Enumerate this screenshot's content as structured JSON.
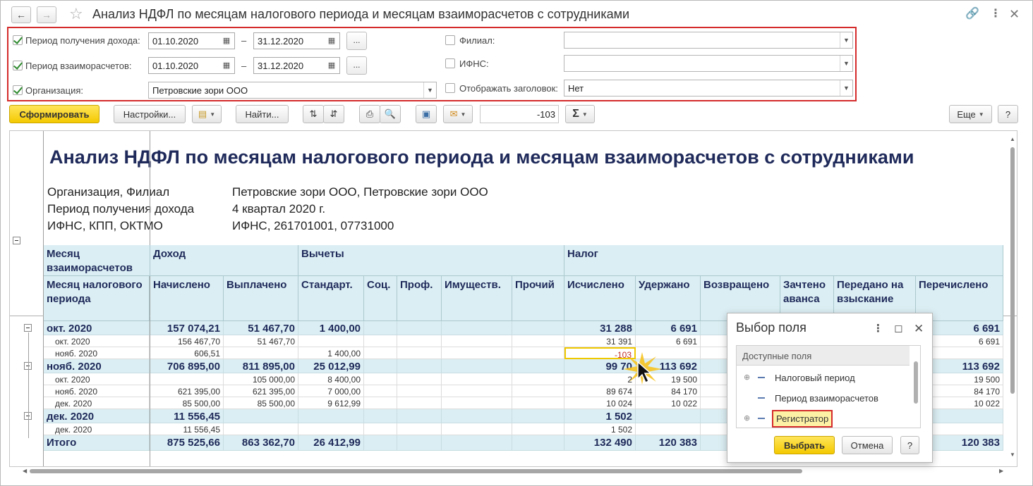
{
  "window": {
    "title": "Анализ НДФЛ по месяцам налогового периода и месяцам взаиморасчетов с сотрудниками"
  },
  "params": {
    "income_period": {
      "label": "Период получения дохода:",
      "checked": true,
      "from": "01.10.2020",
      "to": "31.12.2020"
    },
    "settlement_period": {
      "label": "Период взаиморасчетов:",
      "checked": true,
      "from": "01.10.2020",
      "to": "31.12.2020"
    },
    "organization": {
      "label": "Организация:",
      "checked": true,
      "value": "Петровские зори ООО"
    },
    "branch": {
      "label": "Филиал:",
      "checked": false,
      "value": ""
    },
    "ifns": {
      "label": "ИФНС:",
      "checked": false,
      "value": ""
    },
    "show_header": {
      "label": "Отображать заголовок:",
      "checked": false,
      "value": "Нет"
    },
    "dash": "–",
    "dots": "..."
  },
  "toolbar": {
    "generate": "Сформировать",
    "settings": "Настройки...",
    "find": "Найти...",
    "number_value": "-103",
    "sum_symbol": "Σ",
    "more": "Еще",
    "help": "?"
  },
  "report": {
    "title": "Анализ НДФЛ по месяцам налогового периода и месяцам взаиморасчетов с сотрудниками",
    "info": [
      {
        "label": "Организация, Филиал",
        "value": "Петровские зори ООО, Петровские зори ООО"
      },
      {
        "label": "Период получения дохода",
        "value": "4 квартал 2020 г."
      },
      {
        "label": "ИФНС, КПП, ОКТМО",
        "value": "ИФНС, 261701001, 07731000"
      }
    ],
    "header": {
      "month_settlement": "Месяц взаиморасчетов",
      "month_tax": "Месяц налогового периода",
      "income": "Доход",
      "accrued": "Начислено",
      "paid": "Выплачено",
      "deductions": "Вычеты",
      "standard": "Стандарт.",
      "social": "Соц.",
      "prof": "Проф.",
      "property": "Имуществ.",
      "other": "Прочий",
      "tax": "Налог",
      "calculated": "Исчислено",
      "withheld": "Удержано",
      "returned": "Возвращено",
      "advance": "Зачтено аванса",
      "collection": "Передано на взыскание",
      "transferred": "Перечислено"
    },
    "rows": [
      {
        "type": "grp",
        "label": "окт. 2020",
        "accrued": "157 074,21",
        "paid": "51 467,70",
        "standard": "1 400,00",
        "social": "",
        "prof": "",
        "property": "",
        "other": "",
        "calculated": "31 288",
        "withheld": "6 691",
        "returned": "",
        "advance": "",
        "collection": "",
        "transferred": "6 691"
      },
      {
        "type": "sub",
        "label": "окт. 2020",
        "accrued": "156 467,70",
        "paid": "51 467,70",
        "standard": "",
        "social": "",
        "prof": "",
        "property": "",
        "other": "",
        "calculated": "31 391",
        "withheld": "6 691",
        "returned": "",
        "advance": "",
        "collection": "",
        "transferred": "6 691"
      },
      {
        "type": "sub",
        "label": "нояб. 2020",
        "accrued": "606,51",
        "paid": "",
        "standard": "1 400,00",
        "social": "",
        "prof": "",
        "property": "",
        "other": "",
        "calculated": "-103",
        "withheld": "",
        "returned": "",
        "advance": "",
        "collection": "",
        "transferred": ""
      },
      {
        "type": "grp",
        "label": "нояб. 2020",
        "accrued": "706 895,00",
        "paid": "811 895,00",
        "standard": "25 012,99",
        "social": "",
        "prof": "",
        "property": "",
        "other": "",
        "calculated": "99 70",
        "withheld": "113 692",
        "returned": "",
        "advance": "",
        "collection": "",
        "transferred": "113 692"
      },
      {
        "type": "sub",
        "label": "окт. 2020",
        "accrued": "",
        "paid": "105 000,00",
        "standard": "8 400,00",
        "social": "",
        "prof": "",
        "property": "",
        "other": "",
        "calculated": "2",
        "withheld": "19 500",
        "returned": "",
        "advance": "",
        "collection": "",
        "transferred": "19 500"
      },
      {
        "type": "sub",
        "label": "нояб. 2020",
        "accrued": "621 395,00",
        "paid": "621 395,00",
        "standard": "7 000,00",
        "social": "",
        "prof": "",
        "property": "",
        "other": "",
        "calculated": "89 674",
        "withheld": "84 170",
        "returned": "",
        "advance": "",
        "collection": "",
        "transferred": "84 170"
      },
      {
        "type": "sub",
        "label": "дек. 2020",
        "accrued": "85 500,00",
        "paid": "85 500,00",
        "standard": "9 612,99",
        "social": "",
        "prof": "",
        "property": "",
        "other": "",
        "calculated": "10 024",
        "withheld": "10 022",
        "returned": "",
        "advance": "",
        "collection": "",
        "transferred": "10 022"
      },
      {
        "type": "grp",
        "label": "дек. 2020",
        "accrued": "11 556,45",
        "paid": "",
        "standard": "",
        "social": "",
        "prof": "",
        "property": "",
        "other": "",
        "calculated": "1 502",
        "withheld": "",
        "returned": "",
        "advance": "",
        "collection": "",
        "transferred": ""
      },
      {
        "type": "sub",
        "label": "дек. 2020",
        "accrued": "11 556,45",
        "paid": "",
        "standard": "",
        "social": "",
        "prof": "",
        "property": "",
        "other": "",
        "calculated": "1 502",
        "withheld": "",
        "returned": "",
        "advance": "",
        "collection": "",
        "transferred": ""
      },
      {
        "type": "total",
        "label": "Итого",
        "accrued": "875 525,66",
        "paid": "863 362,70",
        "standard": "26 412,99",
        "social": "",
        "prof": "",
        "property": "",
        "other": "",
        "calculated": "132 490",
        "withheld": "120 383",
        "returned": "",
        "advance": "",
        "collection": "",
        "transferred": "120 383"
      }
    ]
  },
  "popup": {
    "title": "Выбор поля",
    "tree_header": "Доступные поля",
    "items": [
      "Налоговый период",
      "Период взаиморасчетов",
      "Регистратор"
    ],
    "select": "Выбрать",
    "cancel": "Отмена",
    "help": "?"
  },
  "colors": {
    "accent_yellow": "#f4c900",
    "highlight_red": "#d52b2b",
    "header_blue": "#dbeef3",
    "title_navy": "#1f2a5a"
  }
}
